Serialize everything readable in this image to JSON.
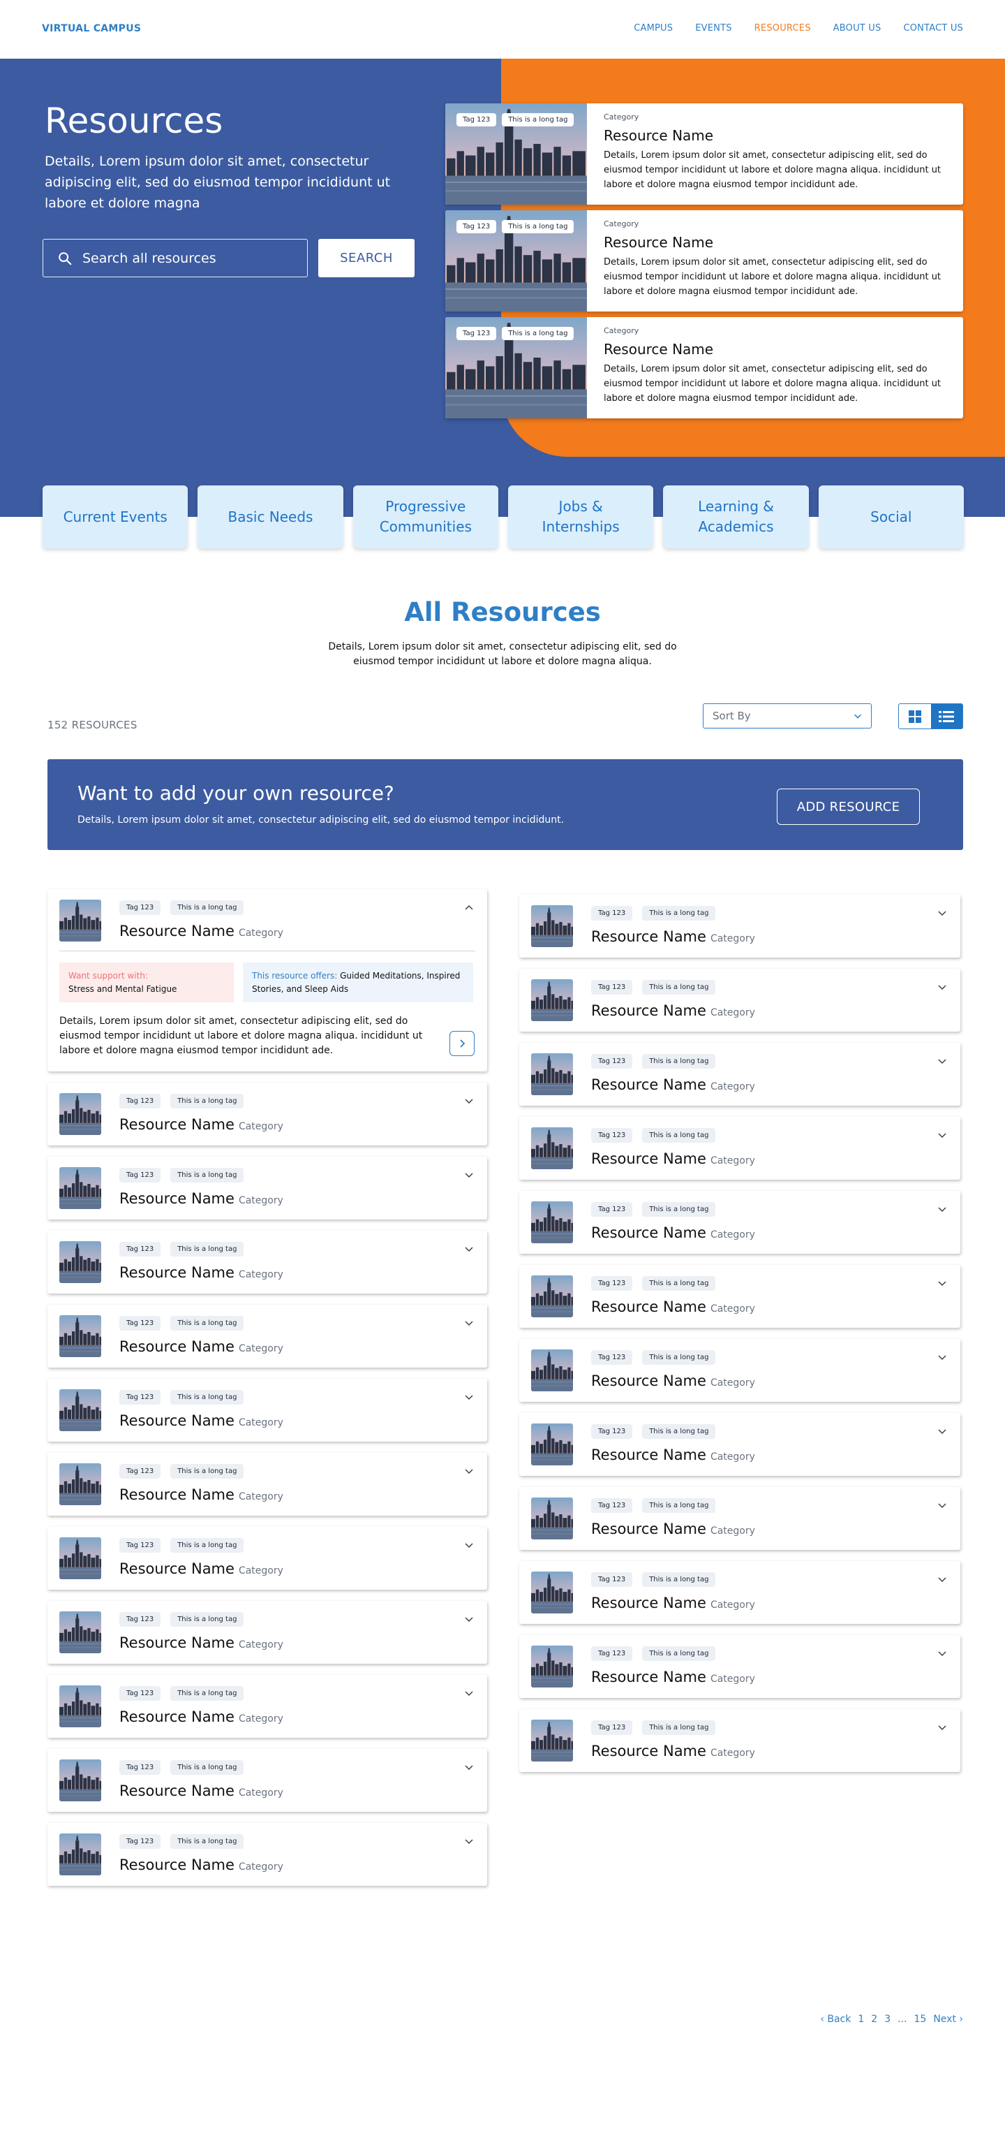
{
  "header": {
    "brand": "VIRTUAL CAMPUS",
    "nav": [
      "CAMPUS",
      "EVENTS",
      "RESOURCES",
      "ABOUT US",
      "CONTACT US"
    ],
    "active_nav": "RESOURCES"
  },
  "hero": {
    "title": "Resources",
    "description": "Details, Lorem ipsum dolor sit amet, consectetur adipiscing elit, sed do eiusmod tempor incididunt ut labore et dolore magna",
    "search_placeholder": "Search all resources",
    "search_button": "SEARCH",
    "featured": [
      {
        "tags": [
          "Tag 123",
          "This is a long tag"
        ],
        "category": "Category",
        "name": "Resource Name",
        "description": "Details, Lorem ipsum dolor sit amet, consectetur adipiscing elit, sed do eiusmod tempor incididunt ut labore et dolore magna aliqua. incididunt ut labore et dolore magna eiusmod tempor incididunt ade."
      },
      {
        "tags": [
          "Tag 123",
          "This is a long tag"
        ],
        "category": "Category",
        "name": "Resource Name",
        "description": "Details, Lorem ipsum dolor sit amet, consectetur adipiscing elit, sed do eiusmod tempor incididunt ut labore et dolore magna aliqua. incididunt ut labore et dolore magna eiusmod tempor incididunt ade."
      },
      {
        "tags": [
          "Tag 123",
          "This is a long tag"
        ],
        "category": "Category",
        "name": "Resource Name",
        "description": "Details, Lorem ipsum dolor sit amet, consectetur adipiscing elit, sed do eiusmod tempor incididunt ut labore et dolore magna aliqua. incididunt ut labore et dolore magna eiusmod tempor incididunt ade."
      }
    ]
  },
  "categories": [
    "Current Events",
    "Basic Needs",
    "Progressive Communities",
    "Jobs & Internships",
    "Learning & Academics",
    "Social"
  ],
  "all_resources": {
    "title": "All Resources",
    "description": "Details, Lorem ipsum dolor sit amet, consectetur adipiscing elit, sed do eiusmod tempor incididunt ut labore et dolore magna aliqua.",
    "count": "152 RESOURCES",
    "sort_label": "Sort By"
  },
  "banner": {
    "title": "Want to add your own resource?",
    "description": "Details, Lorem ipsum dolor sit amet, consectetur adipiscing elit, sed do eiusmod tempor incididunt.",
    "button": "ADD RESOURCE"
  },
  "resource_item": {
    "tags": [
      "Tag 123",
      "This is a long tag"
    ],
    "name": "Resource Name",
    "category": "Category"
  },
  "expanded_item": {
    "support_label": "Want support with:",
    "support_text": "Stress and Mental Fatigue",
    "offers_label": "This resource offers:",
    "offers_text": "Guided Meditations, Inspired Stories, and Sleep Aids",
    "description": "Details, Lorem ipsum dolor sit amet, consectetur adipiscing elit, sed do eiusmod tempor incididunt ut labore et dolore magna aliqua. incididunt ut labore et dolore magna eiusmod tempor incididunt ade."
  },
  "lists": {
    "left_count": 12,
    "right_count": 12
  },
  "pagination": [
    "‹ Back",
    "1",
    "2",
    "3",
    "...",
    "15",
    "Next ›"
  ],
  "colors": {
    "primary": "#3c5ba0",
    "accent": "#f47b1c",
    "link": "#2f7fc6",
    "tile": "#dbeefc"
  }
}
